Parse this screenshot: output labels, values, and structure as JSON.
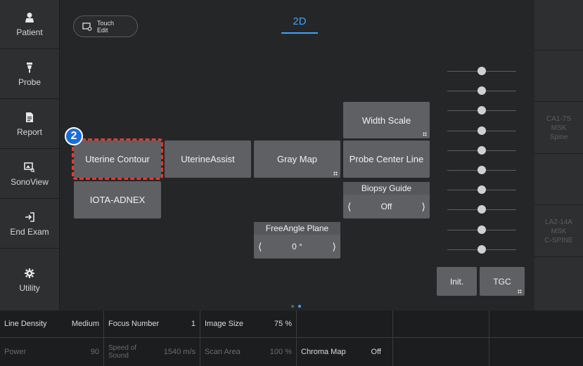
{
  "sidebar": {
    "items": [
      {
        "label": "Patient",
        "icon": "person-icon"
      },
      {
        "label": "Probe",
        "icon": "probe-icon"
      },
      {
        "label": "Report",
        "icon": "document-icon"
      },
      {
        "label": "SonoView",
        "icon": "image-search-icon"
      },
      {
        "label": "End Exam",
        "icon": "exit-icon"
      },
      {
        "label": "Utility",
        "icon": "gear-icon"
      }
    ]
  },
  "probes": [
    {
      "line1": "",
      "line2": "",
      "line3": ""
    },
    {
      "line1": "",
      "line2": "",
      "line3": ""
    },
    {
      "line1": "CA1-7S",
      "line2": "MSK",
      "line3": "Spine"
    },
    {
      "line1": "",
      "line2": "",
      "line3": ""
    },
    {
      "line1": "LA2-14A",
      "line2": "MSK",
      "line3": "C-SPINE"
    },
    {
      "line1": "",
      "line2": "",
      "line3": ""
    }
  ],
  "toolbar": {
    "touch_edit_line1": "Touch",
    "touch_edit_line2": "Edit",
    "mode_tab": "2D"
  },
  "callout": {
    "number": "2"
  },
  "buttons": {
    "width_scale": "Width Scale",
    "uterine_contour": "Uterine Contour",
    "uterine_assist": "UterineAssist",
    "gray_map": "Gray Map",
    "probe_center_line": "Probe Center Line",
    "iota_adnex": "IOTA-ADNEX",
    "init": "Init.",
    "tgc": "TGC"
  },
  "spinners": {
    "biopsy_guide": {
      "title": "Biopsy Guide",
      "value": "Off"
    },
    "free_angle_plane": {
      "title": "FreeAngle Plane",
      "value": "0 °"
    }
  },
  "tgc": {
    "slider_count": 10,
    "knob_positions": [
      0.5,
      0.5,
      0.5,
      0.5,
      0.5,
      0.5,
      0.5,
      0.5,
      0.5,
      0.5
    ]
  },
  "pager": {
    "pages": 2,
    "active": 2
  },
  "bottom_bar": {
    "row1": [
      {
        "key": "Line Density",
        "value": "Medium"
      },
      {
        "key": "Focus Number",
        "value": "1"
      },
      {
        "key": "Image Size",
        "value": "75 %"
      },
      {
        "key": "",
        "value": ""
      },
      {
        "key": "",
        "value": ""
      },
      {
        "key": "",
        "value": ""
      }
    ],
    "row2": [
      {
        "key": "Power",
        "value": "90"
      },
      {
        "key_line1": "Speed of",
        "key_line2": "Sound",
        "value": "1540 m/s"
      },
      {
        "key": "Scan Area",
        "value": "100 %"
      },
      {
        "key": "Chroma Map",
        "value": "Off"
      },
      {
        "key": "",
        "value": ""
      },
      {
        "key": "",
        "value": ""
      }
    ]
  },
  "colors": {
    "accent": "#3fa3ff",
    "highlight": "#e8372e",
    "badge": "#1a6dd7"
  }
}
